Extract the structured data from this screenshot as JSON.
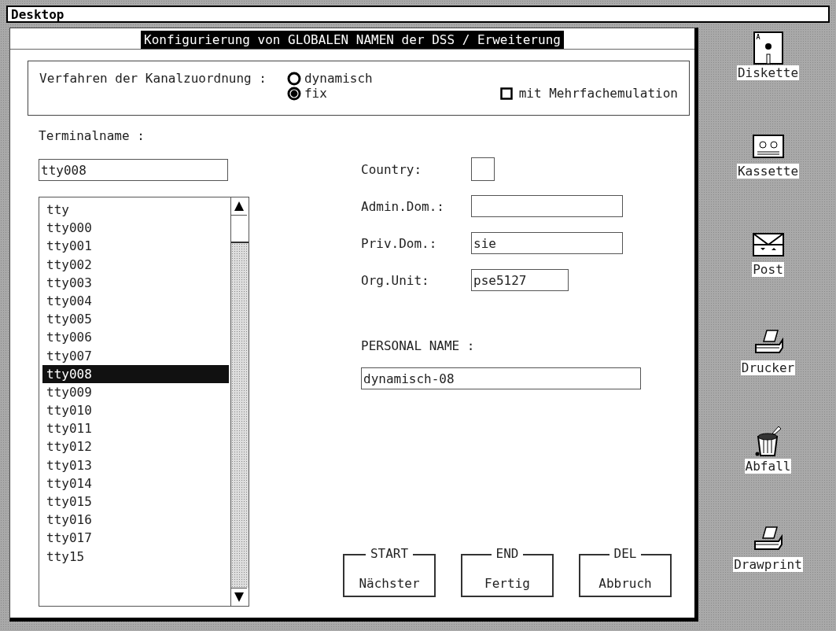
{
  "desktop_bar": {
    "title": "Desktop"
  },
  "dialog": {
    "title": "Konfigurierung von GLOBALEN NAMEN der DSS / Erweiterung"
  },
  "channel_assignment": {
    "label": "Verfahren der Kanalzuordnung :",
    "options": [
      {
        "label": "dynamisch",
        "selected": false
      },
      {
        "label": "fix",
        "selected": true
      }
    ],
    "multi_emulation": {
      "label": "mit Mehrfachemulation",
      "checked": false
    }
  },
  "terminal": {
    "label": "Terminalname :",
    "value": "tty008",
    "items": [
      {
        "label": "tty",
        "selected": false
      },
      {
        "label": "tty000",
        "selected": false
      },
      {
        "label": "tty001",
        "selected": false
      },
      {
        "label": "tty002",
        "selected": false
      },
      {
        "label": "tty003",
        "selected": false
      },
      {
        "label": "tty004",
        "selected": false
      },
      {
        "label": "tty005",
        "selected": false
      },
      {
        "label": "tty006",
        "selected": false
      },
      {
        "label": "tty007",
        "selected": false
      },
      {
        "label": "tty008",
        "selected": true
      },
      {
        "label": "tty009",
        "selected": false
      },
      {
        "label": "tty010",
        "selected": false
      },
      {
        "label": "tty011",
        "selected": false
      },
      {
        "label": "tty012",
        "selected": false
      },
      {
        "label": "tty013",
        "selected": false
      },
      {
        "label": "tty014",
        "selected": false
      },
      {
        "label": "tty015",
        "selected": false
      },
      {
        "label": "tty016",
        "selected": false
      },
      {
        "label": "tty017",
        "selected": false
      },
      {
        "label": "tty15",
        "selected": false
      }
    ]
  },
  "address_fields": [
    {
      "label": "Country:",
      "kind": "small"
    },
    {
      "label": "Admin.Dom.:",
      "kind": "wide"
    },
    {
      "label": "Priv.Dom.:",
      "kind": "wide",
      "value": "sie"
    },
    {
      "label": "Org.Unit:",
      "kind": "medium",
      "value": "pse5127"
    }
  ],
  "personal_name": {
    "label": "PERSONAL NAME :",
    "value": "dynamisch-08"
  },
  "buttons": [
    {
      "key": "START",
      "label": "Nächster"
    },
    {
      "key": "END",
      "label": "Fertig"
    },
    {
      "key": "DEL",
      "label": "Abbruch"
    }
  ],
  "desktop_icons": [
    {
      "kind": "disk",
      "label": "Diskette"
    },
    {
      "kind": "cassette",
      "label": "Kassette"
    },
    {
      "kind": "mail",
      "label": "Post"
    },
    {
      "kind": "printer",
      "label": "Drucker"
    },
    {
      "kind": "trash",
      "label": "Abfall"
    },
    {
      "kind": "printer",
      "label": "Drawprint"
    }
  ]
}
